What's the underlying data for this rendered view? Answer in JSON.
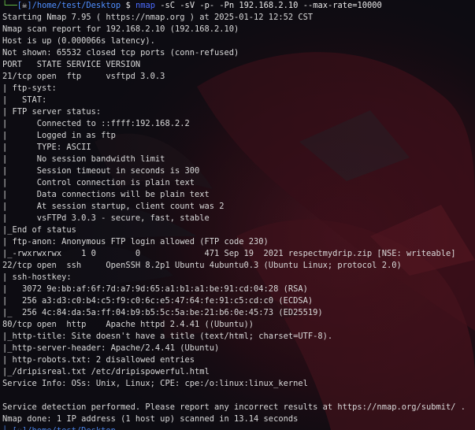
{
  "prompt": {
    "user_icon": "skull-icon",
    "path": "/home/test/Desktop",
    "symbol": "$",
    "command_name": "nmap",
    "command_args": "-sC -sV -p- -Pn 192.168.2.10 --max-rate=10000"
  },
  "output_lines": [
    "Starting Nmap 7.95 ( https://nmap.org ) at 2025-01-12 12:52 CST",
    "Nmap scan report for 192.168.2.10 (192.168.2.10)",
    "Host is up (0.000066s latency).",
    "Not shown: 65532 closed tcp ports (conn-refused)",
    "PORT   STATE SERVICE VERSION",
    "21/tcp open  ftp     vsftpd 3.0.3",
    "| ftp-syst:",
    "|   STAT:",
    "| FTP server status:",
    "|      Connected to ::ffff:192.168.2.2",
    "|      Logged in as ftp",
    "|      TYPE: ASCII",
    "|      No session bandwidth limit",
    "|      Session timeout in seconds is 300",
    "|      Control connection is plain text",
    "|      Data connections will be plain text",
    "|      At session startup, client count was 2",
    "|      vsFTPd 3.0.3 - secure, fast, stable",
    "|_End of status",
    "| ftp-anon: Anonymous FTP login allowed (FTP code 230)",
    "|_-rwxrwxrwx    1 0        0             471 Sep 19  2021 respectmydrip.zip [NSE: writeable]",
    "22/tcp open  ssh     OpenSSH 8.2p1 Ubuntu 4ubuntu0.3 (Ubuntu Linux; protocol 2.0)",
    "| ssh-hostkey:",
    "|   3072 9e:bb:af:6f:7d:a7:9d:65:a1:b1:a1:be:91:cd:04:28 (RSA)",
    "|   256 a3:d3:c0:b4:c5:f9:c0:6c:e5:47:64:fe:91:c5:cd:c0 (ECDSA)",
    "|_  256 4c:84:da:5a:ff:04:b9:b5:5c:5a:be:21:b6:0e:45:73 (ED25519)",
    "80/tcp open  http    Apache httpd 2.4.41 ((Ubuntu))",
    "|_http-title: Site doesn't have a title (text/html; charset=UTF-8).",
    "|_http-server-header: Apache/2.4.41 (Ubuntu)",
    "| http-robots.txt: 2 disallowed entries",
    "|_/dripisreal.txt /etc/dripispowerful.html",
    "Service Info: OSs: Unix, Linux; CPE: cpe:/o:linux:linux_kernel",
    "",
    "Service detection performed. Please report any incorrect results at https://nmap.org/submit/ .",
    "Nmap done: 1 IP address (1 host up) scanned in 13.14 seconds"
  ],
  "next_prompt_partial": "└─[☠]/home/test/Desktop",
  "colors": {
    "background": "#0d0c12",
    "text": "#d9d9d9",
    "prompt_green": "#6fd24c",
    "prompt_blue": "#4f8fff",
    "command": "#4b6cff",
    "wallpaper_red": "#5a1822"
  }
}
